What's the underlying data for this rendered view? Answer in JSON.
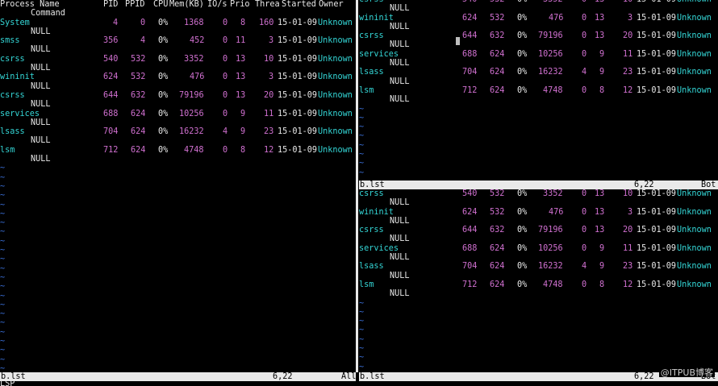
{
  "header": {
    "process_name": "Process Name",
    "command": "Command",
    "pid": "PID",
    "ppid": "PPID",
    "cpu": "CPU",
    "mem": "Mem(KB)",
    "io": "IO/s",
    "prio": "Prio",
    "threa": "Threa",
    "started": "Started",
    "owner": "Owner"
  },
  "rows": [
    {
      "name": "System",
      "pid": "4",
      "ppid": "0",
      "cpu": "0%",
      "mem": "1368",
      "io": "0",
      "prio": "8",
      "thr": "160",
      "started": "15-01-09",
      "owner": "Unknown",
      "cmd": "NULL"
    },
    {
      "name": "smss",
      "pid": "356",
      "ppid": "4",
      "cpu": "0%",
      "mem": "452",
      "io": "0",
      "prio": "11",
      "thr": "3",
      "started": "15-01-09",
      "owner": "Unknown",
      "cmd": "NULL"
    },
    {
      "name": "csrss",
      "pid": "540",
      "ppid": "532",
      "cpu": "0%",
      "mem": "3352",
      "io": "0",
      "prio": "13",
      "thr": "10",
      "started": "15-01-09",
      "owner": "Unknown",
      "cmd": "NULL"
    },
    {
      "name": "wininit",
      "pid": "624",
      "ppid": "532",
      "cpu": "0%",
      "mem": "476",
      "io": "0",
      "prio": "13",
      "thr": "3",
      "started": "15-01-09",
      "owner": "Unknown",
      "cmd": "NULL"
    },
    {
      "name": "csrss",
      "pid": "644",
      "ppid": "632",
      "cpu": "0%",
      "mem": "79196",
      "io": "0",
      "prio": "13",
      "thr": "20",
      "started": "15-01-09",
      "owner": "Unknown",
      "cmd": "NULL"
    },
    {
      "name": "services",
      "pid": "688",
      "ppid": "624",
      "cpu": "0%",
      "mem": "10256",
      "io": "0",
      "prio": "9",
      "thr": "11",
      "started": "15-01-09",
      "owner": "Unknown",
      "cmd": "NULL"
    },
    {
      "name": "lsass",
      "pid": "704",
      "ppid": "624",
      "cpu": "0%",
      "mem": "16232",
      "io": "4",
      "prio": "9",
      "thr": "23",
      "started": "15-01-09",
      "owner": "Unknown",
      "cmd": "NULL"
    },
    {
      "name": "lsm",
      "pid": "712",
      "ppid": "624",
      "cpu": "0%",
      "mem": "4748",
      "io": "0",
      "prio": "8",
      "thr": "12",
      "started": "15-01-09",
      "owner": "Unknown",
      "cmd": "NULL"
    }
  ],
  "left_status": {
    "file": "b.lst",
    "pos": "6,22",
    "scroll": "All"
  },
  "right_top_status": {
    "file": "b.lst",
    "pos": "6,22",
    "scroll": "Bot"
  },
  "right_bottom_status": {
    "file": "b.lst",
    "pos": "6,22",
    "scroll": "Bot"
  },
  "tilde": "~",
  "cmdline": "LSP",
  "watermark": "@ITPUB博客",
  "colors": {
    "name": "#34d6d6",
    "number": "#d070d0",
    "tilde": "#3a6fd8",
    "status_bg": "#e9e9e9"
  }
}
